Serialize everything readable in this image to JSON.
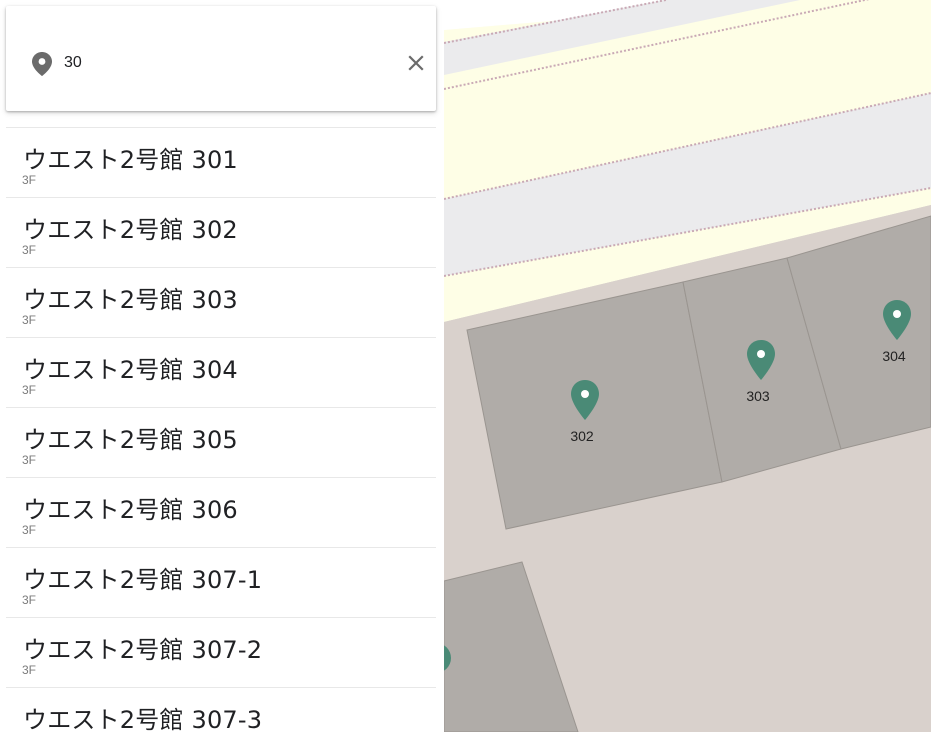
{
  "search": {
    "value": "30",
    "placeholder": "",
    "clear_label": "Clear search"
  },
  "results": [
    {
      "title": "ウエスト2号館 301",
      "floor": "3F"
    },
    {
      "title": "ウエスト2号館 302",
      "floor": "3F"
    },
    {
      "title": "ウエスト2号館 303",
      "floor": "3F"
    },
    {
      "title": "ウエスト2号館 304",
      "floor": "3F"
    },
    {
      "title": "ウエスト2号館 305",
      "floor": "3F"
    },
    {
      "title": "ウエスト2号館 306",
      "floor": "3F"
    },
    {
      "title": "ウエスト2号館 307-1",
      "floor": "3F"
    },
    {
      "title": "ウエスト2号館 307-2",
      "floor": "3F"
    },
    {
      "title": "ウエスト2号館 307-3",
      "floor": ""
    }
  ],
  "map": {
    "pins": [
      {
        "label": "302"
      },
      {
        "label": "303"
      },
      {
        "label": "304"
      }
    ],
    "colors": {
      "ground": "#d9d1cc",
      "room": "#b0aca8",
      "room_border": "#9a9590",
      "road_yellow": "#fefee6",
      "road_gray": "#ebebed",
      "road_edge": "#c9a9b5",
      "pin": "#4a8a76"
    }
  },
  "colors": {
    "icon": "#6b6b6b",
    "text": "#202124",
    "subtext": "#7a7a7a"
  }
}
